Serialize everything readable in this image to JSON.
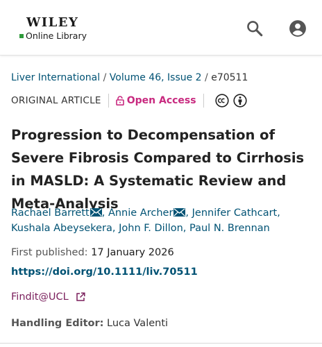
{
  "header": {
    "logo_wiley": "WILEY",
    "logo_online_library": "Online Library",
    "icons": {
      "search": "search-icon",
      "account": "account-icon"
    },
    "colors": {
      "logo_square": "#2e9a3a"
    }
  },
  "breadcrumb": {
    "journal": "Liver International",
    "volume": "Volume 46, Issue 2",
    "article_id": "e70511"
  },
  "meta": {
    "article_type": "ORIGINAL ARTICLE",
    "open_access": "Open Access",
    "icons": {
      "open_access": "lock-open-icon",
      "license_cc": "cc-icon",
      "license_by": "by-icon"
    },
    "colors": {
      "open_access": "#c8297f"
    }
  },
  "title": "Progression to Decompensation of Severe Fibrosis Compared to Cirrhosis in MASLD: A Systematic Review and Meta-Analysis",
  "authors": [
    {
      "name": "Rachael Barrett",
      "corresponding": true
    },
    {
      "name": "Annie Archer",
      "corresponding": true
    },
    {
      "name": "Jennifer Cathcart",
      "corresponding": false
    },
    {
      "name": "Kushala Abeysekera",
      "corresponding": false
    },
    {
      "name": "John F. Dillon",
      "corresponding": false
    },
    {
      "name": "Paul N. Brennan",
      "corresponding": false
    }
  ],
  "published": {
    "label": "First published:",
    "date": "17 January 2026"
  },
  "doi": "https://doi.org/10.1111/liv.70511",
  "findit": {
    "label": "Findit@UCL",
    "icon": "external-link-icon"
  },
  "editor": {
    "label": "Handling Editor:",
    "name": "Luca Valenti"
  },
  "colors": {
    "link": "#005274",
    "findit": "#7a1f5c"
  }
}
